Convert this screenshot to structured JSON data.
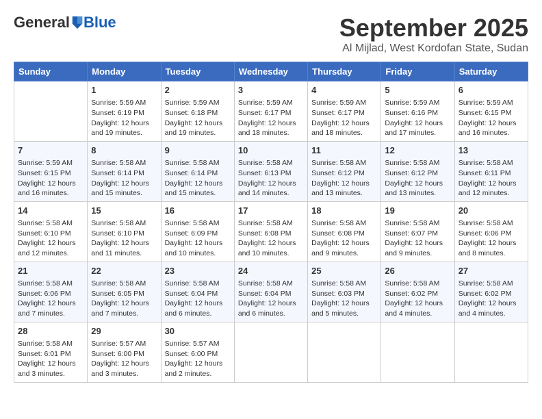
{
  "header": {
    "logo_general": "General",
    "logo_blue": "Blue",
    "month": "September 2025",
    "location": "Al Mijlad, West Kordofan State, Sudan"
  },
  "days_of_week": [
    "Sunday",
    "Monday",
    "Tuesday",
    "Wednesday",
    "Thursday",
    "Friday",
    "Saturday"
  ],
  "weeks": [
    [
      {
        "day": "",
        "info": ""
      },
      {
        "day": "1",
        "info": "Sunrise: 5:59 AM\nSunset: 6:19 PM\nDaylight: 12 hours\nand 19 minutes."
      },
      {
        "day": "2",
        "info": "Sunrise: 5:59 AM\nSunset: 6:18 PM\nDaylight: 12 hours\nand 19 minutes."
      },
      {
        "day": "3",
        "info": "Sunrise: 5:59 AM\nSunset: 6:17 PM\nDaylight: 12 hours\nand 18 minutes."
      },
      {
        "day": "4",
        "info": "Sunrise: 5:59 AM\nSunset: 6:17 PM\nDaylight: 12 hours\nand 18 minutes."
      },
      {
        "day": "5",
        "info": "Sunrise: 5:59 AM\nSunset: 6:16 PM\nDaylight: 12 hours\nand 17 minutes."
      },
      {
        "day": "6",
        "info": "Sunrise: 5:59 AM\nSunset: 6:15 PM\nDaylight: 12 hours\nand 16 minutes."
      }
    ],
    [
      {
        "day": "7",
        "info": "Sunrise: 5:59 AM\nSunset: 6:15 PM\nDaylight: 12 hours\nand 16 minutes."
      },
      {
        "day": "8",
        "info": "Sunrise: 5:58 AM\nSunset: 6:14 PM\nDaylight: 12 hours\nand 15 minutes."
      },
      {
        "day": "9",
        "info": "Sunrise: 5:58 AM\nSunset: 6:14 PM\nDaylight: 12 hours\nand 15 minutes."
      },
      {
        "day": "10",
        "info": "Sunrise: 5:58 AM\nSunset: 6:13 PM\nDaylight: 12 hours\nand 14 minutes."
      },
      {
        "day": "11",
        "info": "Sunrise: 5:58 AM\nSunset: 6:12 PM\nDaylight: 12 hours\nand 13 minutes."
      },
      {
        "day": "12",
        "info": "Sunrise: 5:58 AM\nSunset: 6:12 PM\nDaylight: 12 hours\nand 13 minutes."
      },
      {
        "day": "13",
        "info": "Sunrise: 5:58 AM\nSunset: 6:11 PM\nDaylight: 12 hours\nand 12 minutes."
      }
    ],
    [
      {
        "day": "14",
        "info": "Sunrise: 5:58 AM\nSunset: 6:10 PM\nDaylight: 12 hours\nand 12 minutes."
      },
      {
        "day": "15",
        "info": "Sunrise: 5:58 AM\nSunset: 6:10 PM\nDaylight: 12 hours\nand 11 minutes."
      },
      {
        "day": "16",
        "info": "Sunrise: 5:58 AM\nSunset: 6:09 PM\nDaylight: 12 hours\nand 10 minutes."
      },
      {
        "day": "17",
        "info": "Sunrise: 5:58 AM\nSunset: 6:08 PM\nDaylight: 12 hours\nand 10 minutes."
      },
      {
        "day": "18",
        "info": "Sunrise: 5:58 AM\nSunset: 6:08 PM\nDaylight: 12 hours\nand 9 minutes."
      },
      {
        "day": "19",
        "info": "Sunrise: 5:58 AM\nSunset: 6:07 PM\nDaylight: 12 hours\nand 9 minutes."
      },
      {
        "day": "20",
        "info": "Sunrise: 5:58 AM\nSunset: 6:06 PM\nDaylight: 12 hours\nand 8 minutes."
      }
    ],
    [
      {
        "day": "21",
        "info": "Sunrise: 5:58 AM\nSunset: 6:06 PM\nDaylight: 12 hours\nand 7 minutes."
      },
      {
        "day": "22",
        "info": "Sunrise: 5:58 AM\nSunset: 6:05 PM\nDaylight: 12 hours\nand 7 minutes."
      },
      {
        "day": "23",
        "info": "Sunrise: 5:58 AM\nSunset: 6:04 PM\nDaylight: 12 hours\nand 6 minutes."
      },
      {
        "day": "24",
        "info": "Sunrise: 5:58 AM\nSunset: 6:04 PM\nDaylight: 12 hours\nand 6 minutes."
      },
      {
        "day": "25",
        "info": "Sunrise: 5:58 AM\nSunset: 6:03 PM\nDaylight: 12 hours\nand 5 minutes."
      },
      {
        "day": "26",
        "info": "Sunrise: 5:58 AM\nSunset: 6:02 PM\nDaylight: 12 hours\nand 4 minutes."
      },
      {
        "day": "27",
        "info": "Sunrise: 5:58 AM\nSunset: 6:02 PM\nDaylight: 12 hours\nand 4 minutes."
      }
    ],
    [
      {
        "day": "28",
        "info": "Sunrise: 5:58 AM\nSunset: 6:01 PM\nDaylight: 12 hours\nand 3 minutes."
      },
      {
        "day": "29",
        "info": "Sunrise: 5:57 AM\nSunset: 6:00 PM\nDaylight: 12 hours\nand 3 minutes."
      },
      {
        "day": "30",
        "info": "Sunrise: 5:57 AM\nSunset: 6:00 PM\nDaylight: 12 hours\nand 2 minutes."
      },
      {
        "day": "",
        "info": ""
      },
      {
        "day": "",
        "info": ""
      },
      {
        "day": "",
        "info": ""
      },
      {
        "day": "",
        "info": ""
      }
    ]
  ]
}
